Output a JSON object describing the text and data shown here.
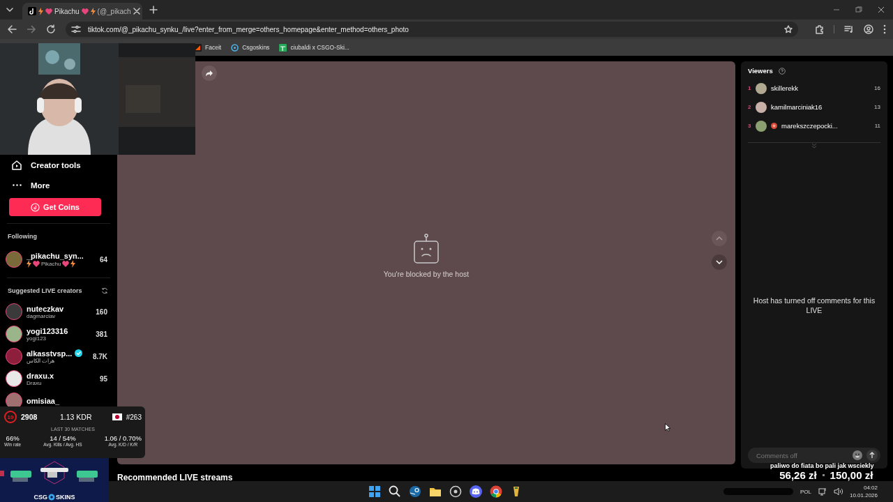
{
  "browser": {
    "tab": {
      "title": "Pikachu",
      "handle": "(@_pikach",
      "selected": true
    },
    "address": "tiktok.com/@_pikachu_synku_/live?enter_from_merge=others_homepage&enter_method=others_photo",
    "bookmarks": [
      {
        "label": "Faceit"
      },
      {
        "label": "Csgoskins"
      },
      {
        "label": "ciubaldi x CSGO-Ski..."
      }
    ]
  },
  "sidebar": {
    "nav": [
      {
        "label": "Creator tools"
      },
      {
        "label": "More"
      }
    ],
    "coins_button": "Get Coins",
    "following_title": "Following",
    "following": [
      {
        "name": "_pikachu_syn...",
        "subtitle": "Pikachu",
        "viewers": "64",
        "decorated": true,
        "color": "#7a6a3a"
      }
    ],
    "suggested_title": "Suggested LIVE creators",
    "suggested": [
      {
        "name": "nuteczkav",
        "subtitle": "dagmarciav",
        "viewers": "160",
        "verified": false,
        "color": "#3a3a3a"
      },
      {
        "name": "yogi123316",
        "subtitle": "yogi123",
        "viewers": "381",
        "verified": false,
        "color": "#9ab58a"
      },
      {
        "name": "alkasstvsp...",
        "subtitle": "هرات الكاس",
        "viewers": "8.7K",
        "verified": true,
        "color": "#8e1f3c"
      },
      {
        "name": "draxu.x",
        "subtitle": "Draxu",
        "viewers": "95",
        "verified": false,
        "color": "#e8e8e8"
      },
      {
        "name": "omisiaa_",
        "verified": false,
        "color": "#a07070"
      }
    ]
  },
  "video": {
    "message": "You're blocked by the host"
  },
  "recommended_title": "Recommended LIVE streams",
  "viewers_panel": {
    "title": "Viewers",
    "viewers": [
      {
        "rank": "1",
        "name": "skillerekk",
        "count": "16",
        "badge": false,
        "color": "#b0a890"
      },
      {
        "rank": "2",
        "name": "kamilmarciniak16",
        "count": "13",
        "badge": false,
        "color": "#c8b0a8"
      },
      {
        "rank": "3",
        "name": "marekszczepocki...",
        "count": "11",
        "badge": true,
        "color": "#8aa070"
      }
    ],
    "comments_notice": "Host has turned off comments for this LIVE",
    "comment_placeholder": "Comments off"
  },
  "stats_overlay": {
    "level": "10",
    "elo": "2908",
    "kdr": "1.13 KDR",
    "rank": "#263",
    "period": "LAST 30 MATCHES",
    "stats": [
      {
        "value": "66%",
        "label": "Win rate"
      },
      {
        "value": "14 / 54%",
        "label": "Avg. Kills / Avg. HS"
      },
      {
        "value": "1.06 / 0.70%",
        "label": "Avg. K/D / K/R"
      }
    ]
  },
  "ad_banner": {
    "brand_left": "CSG",
    "brand_right": "SKINS"
  },
  "donation": {
    "message": "paliwo do fiata bo pali jak wsciekly",
    "current": "56,26 zł",
    "goal": "150,00 zł"
  },
  "taskbar": {
    "icons": [
      {
        "kind": "start"
      },
      {
        "kind": "search"
      },
      {
        "kind": "steam"
      },
      {
        "kind": "folder"
      },
      {
        "kind": "circle"
      },
      {
        "kind": "discord"
      },
      {
        "kind": "chrome"
      },
      {
        "kind": "app"
      }
    ],
    "language": "POL",
    "time": "04:02",
    "date": "10.01.2026"
  }
}
